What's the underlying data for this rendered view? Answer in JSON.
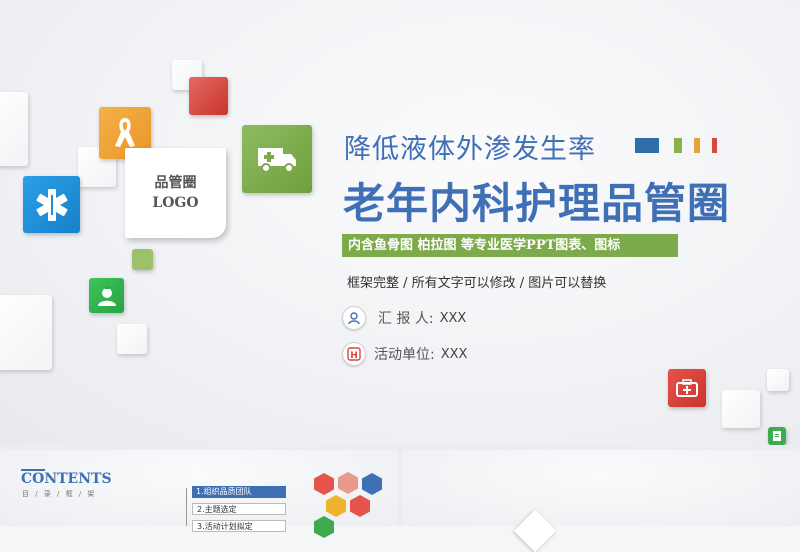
{
  "slide": {
    "subtitle": "降低液体外渗发生率",
    "title": "老年内科护理品管圈",
    "banner": "内含鱼骨图 柏拉图 等专业医学PPT图表、图标",
    "description": "框架完整 / 所有文字可以修改 / 图片可以替换",
    "logo_line1": "品管圈",
    "logo_line2": "LOGO",
    "reporter_label": "汇 报 人:",
    "reporter_value": "XXX",
    "unit_label": "活动单位:",
    "unit_value": "XXX",
    "accent_bars": [
      "#2e6faa",
      "#8ab14f",
      "#e8a23a",
      "#d9473e"
    ]
  },
  "thumb_contents": {
    "heading": "CONTENTS",
    "sub": "目 / 录 / 框 / 架",
    "items": [
      "1.组织品质团队",
      "2.主题选定",
      "3.活动计划拟定"
    ]
  },
  "icons": [
    "ribbon-icon",
    "ambulance-icon",
    "star-of-life-icon",
    "nurse-icon",
    "first-aid-kit-icon",
    "nurse-avatar-icon",
    "hospital-icon",
    "document-icon"
  ],
  "colors": {
    "brand_blue": "#3f6fb5",
    "green": "#7daa4b",
    "orange": "#f0a33a",
    "red": "#d9473e",
    "sky_blue": "#1d8fd9"
  }
}
